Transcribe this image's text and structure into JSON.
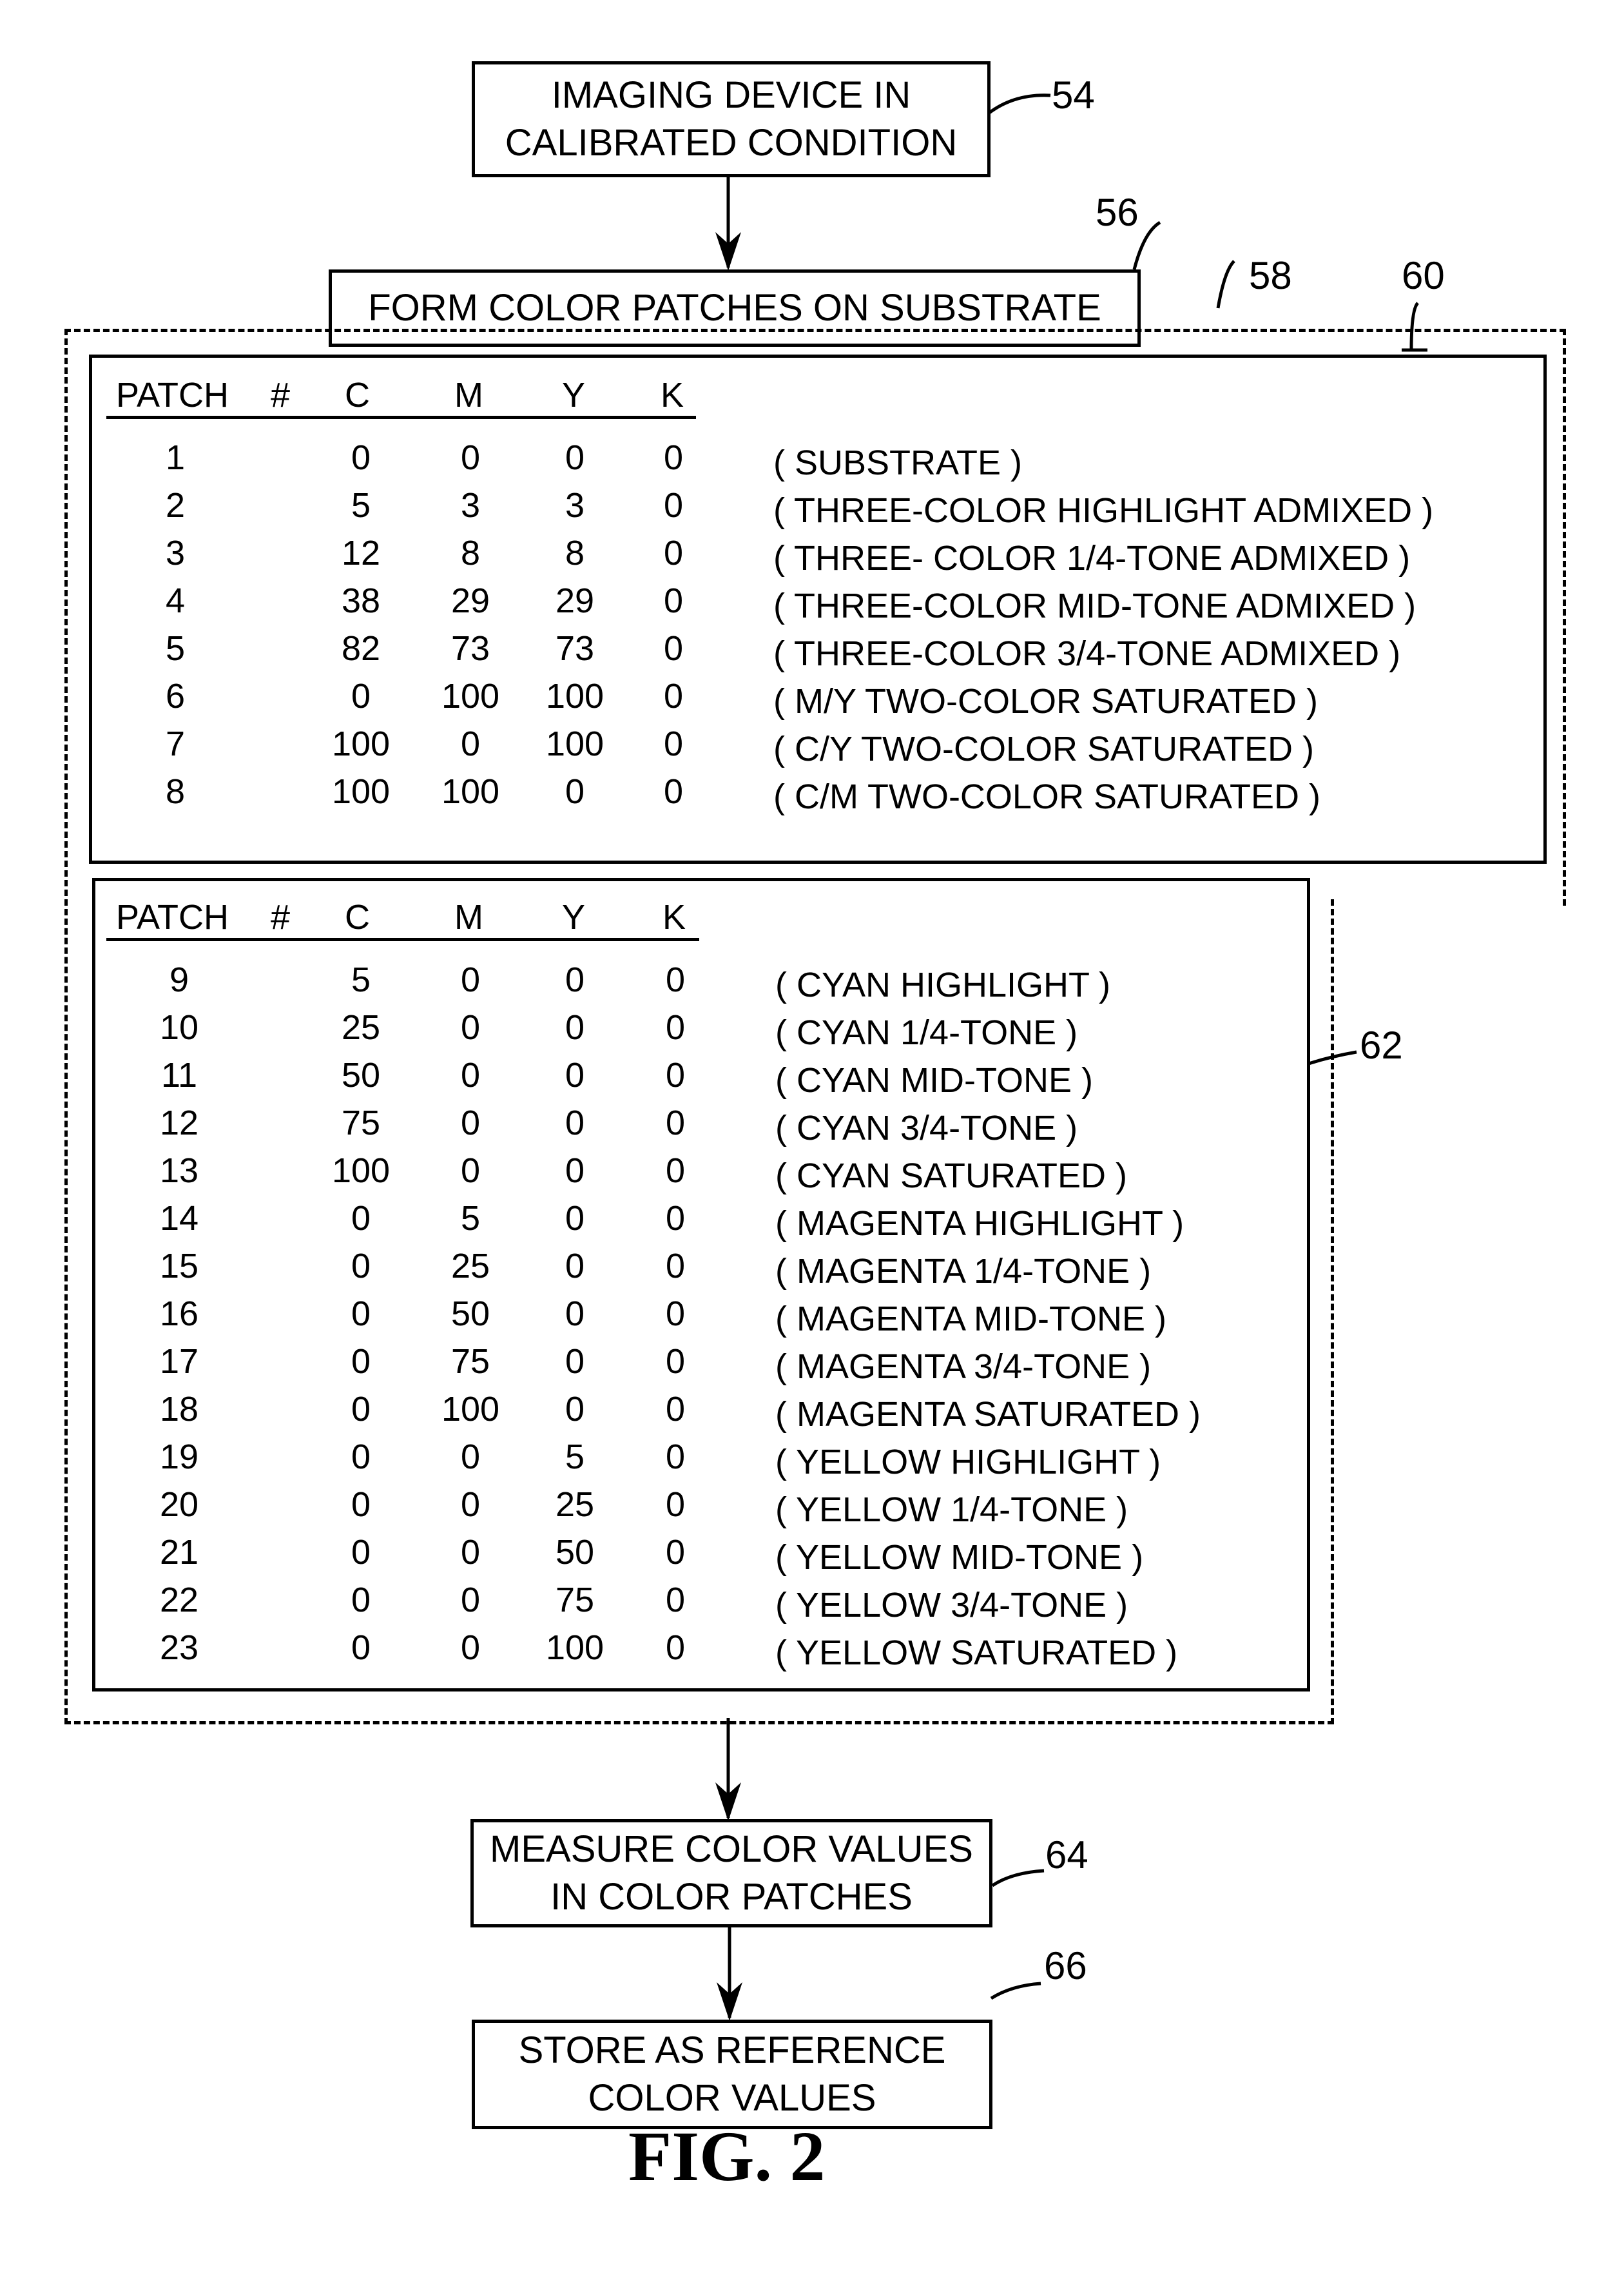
{
  "steps": {
    "s54": {
      "lines": [
        "IMAGING DEVICE IN",
        "CALIBRATED CONDITION"
      ],
      "ref": "54"
    },
    "s56": {
      "lines": [
        "FORM COLOR PATCHES ON SUBSTRATE"
      ],
      "ref": "56"
    },
    "s64": {
      "lines": [
        "MEASURE COLOR VALUES",
        "IN COLOR PATCHES"
      ],
      "ref": "64"
    },
    "s66": {
      "lines": [
        "STORE AS REFERENCE",
        "COLOR VALUES"
      ],
      "ref": "66"
    }
  },
  "group_ref": "60",
  "table1": {
    "ref": "58",
    "headers": {
      "patch": "PATCH",
      "hash": "#",
      "c": "C",
      "m": "M",
      "y": "Y",
      "k": "K"
    },
    "rows": [
      {
        "patch": "1",
        "c": "0",
        "m": "0",
        "y": "0",
        "k": "0",
        "desc": "( SUBSTRATE )"
      },
      {
        "patch": "2",
        "c": "5",
        "m": "3",
        "y": "3",
        "k": "0",
        "desc": "( THREE-COLOR HIGHLIGHT ADMIXED )"
      },
      {
        "patch": "3",
        "c": "12",
        "m": "8",
        "y": "8",
        "k": "0",
        "desc": "( THREE- COLOR 1/4-TONE ADMIXED )"
      },
      {
        "patch": "4",
        "c": "38",
        "m": "29",
        "y": "29",
        "k": "0",
        "desc": "( THREE-COLOR MID-TONE ADMIXED )"
      },
      {
        "patch": "5",
        "c": "82",
        "m": "73",
        "y": "73",
        "k": "0",
        "desc": "( THREE-COLOR 3/4-TONE ADMIXED )"
      },
      {
        "patch": "6",
        "c": "0",
        "m": "100",
        "y": "100",
        "k": "0",
        "desc": "( M/Y TWO-COLOR SATURATED )"
      },
      {
        "patch": "7",
        "c": "100",
        "m": "0",
        "y": "100",
        "k": "0",
        "desc": "( C/Y TWO-COLOR SATURATED )"
      },
      {
        "patch": "8",
        "c": "100",
        "m": "100",
        "y": "0",
        "k": "0",
        "desc": "( C/M TWO-COLOR SATURATED )"
      }
    ]
  },
  "table2": {
    "ref": "62",
    "headers": {
      "patch": "PATCH",
      "hash": "#",
      "c": "C",
      "m": "M",
      "y": "Y",
      "k": "K"
    },
    "rows": [
      {
        "patch": "9",
        "c": "5",
        "m": "0",
        "y": "0",
        "k": "0",
        "desc": "( CYAN HIGHLIGHT )"
      },
      {
        "patch": "10",
        "c": "25",
        "m": "0",
        "y": "0",
        "k": "0",
        "desc": "( CYAN 1/4-TONE )"
      },
      {
        "patch": "11",
        "c": "50",
        "m": "0",
        "y": "0",
        "k": "0",
        "desc": "( CYAN MID-TONE )"
      },
      {
        "patch": "12",
        "c": "75",
        "m": "0",
        "y": "0",
        "k": "0",
        "desc": "( CYAN 3/4-TONE )"
      },
      {
        "patch": "13",
        "c": "100",
        "m": "0",
        "y": "0",
        "k": "0",
        "desc": "( CYAN  SATURATED )"
      },
      {
        "patch": "14",
        "c": "0",
        "m": "5",
        "y": "0",
        "k": "0",
        "desc": "( MAGENTA HIGHLIGHT )"
      },
      {
        "patch": "15",
        "c": "0",
        "m": "25",
        "y": "0",
        "k": "0",
        "desc": "( MAGENTA 1/4-TONE )"
      },
      {
        "patch": "16",
        "c": "0",
        "m": "50",
        "y": "0",
        "k": "0",
        "desc": "( MAGENTA MID-TONE )"
      },
      {
        "patch": "17",
        "c": "0",
        "m": "75",
        "y": "0",
        "k": "0",
        "desc": "( MAGENTA 3/4-TONE )"
      },
      {
        "patch": "18",
        "c": "0",
        "m": "100",
        "y": "0",
        "k": "0",
        "desc": "( MAGENTA  SATURATED )"
      },
      {
        "patch": "19",
        "c": "0",
        "m": "0",
        "y": "5",
        "k": "0",
        "desc": "( YELLOW HIGHLIGHT )"
      },
      {
        "patch": "20",
        "c": "0",
        "m": "0",
        "y": "25",
        "k": "0",
        "desc": "( YELLOW 1/4-TONE )"
      },
      {
        "patch": "21",
        "c": "0",
        "m": "0",
        "y": "50",
        "k": "0",
        "desc": "( YELLOW MID-TONE )"
      },
      {
        "patch": "22",
        "c": "0",
        "m": "0",
        "y": "75",
        "k": "0",
        "desc": "( YELLOW 3/4-TONE )"
      },
      {
        "patch": "23",
        "c": "0",
        "m": "0",
        "y": "100",
        "k": "0",
        "desc": "( YELLOW  SATURATED )"
      }
    ]
  },
  "figure_label": "FIG. 2"
}
